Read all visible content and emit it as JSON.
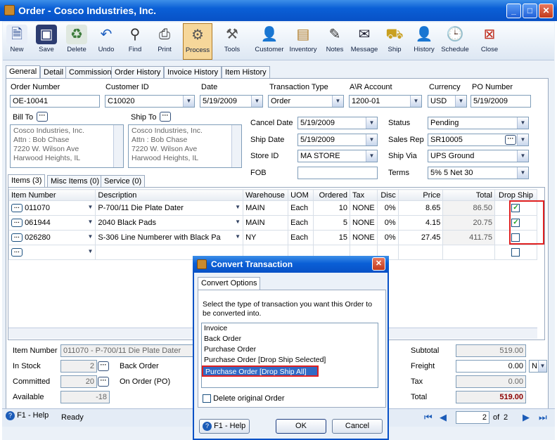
{
  "window": {
    "title": "Order - Cosco Industries, Inc."
  },
  "toolbar": {
    "items": [
      "New",
      "Save",
      "Delete",
      "Undo",
      "Find",
      "Print",
      "Process",
      "Tools",
      "Customer",
      "Inventory",
      "Notes",
      "Message",
      "Ship",
      "History",
      "Schedule",
      "Close"
    ]
  },
  "tabs": [
    "General",
    "Detail",
    "Commission",
    "Order History",
    "Invoice History",
    "Item History"
  ],
  "header": {
    "order_number_label": "Order Number",
    "order_number": "OE-10041",
    "customer_id_label": "Customer ID",
    "customer_id": "C10020",
    "date_label": "Date",
    "date": "5/19/2009",
    "transaction_type_label": "Transaction Type",
    "transaction_type": "Order",
    "ar_account_label": "A\\R Account",
    "ar_account": "1200-01",
    "currency_label": "Currency",
    "currency": "USD",
    "po_number_label": "PO Number",
    "po_number": "5/19/2009"
  },
  "bill_to": {
    "label": "Bill To",
    "lines": [
      "Cosco Industries, Inc.",
      "Attn : Bob Chase",
      "7220 W. Wilson Ave",
      "Harwood Heights, IL"
    ]
  },
  "ship_to": {
    "label": "Ship To",
    "lines": [
      "Cosco Industries, Inc.",
      "Attn : Bob Chase",
      "7220 W. Wilson Ave",
      "Harwood Heights, IL"
    ]
  },
  "mid": {
    "cancel_date_label": "Cancel  Date",
    "cancel_date": "5/19/2009",
    "ship_date_label": "Ship Date",
    "ship_date": "5/19/2009",
    "store_id_label": "Store ID",
    "store_id": "MA STORE",
    "fob_label": "FOB",
    "fob": ""
  },
  "right": {
    "status_label": "Status",
    "status": "Pending",
    "sales_rep_label": "Sales Rep",
    "sales_rep": "SR10005",
    "ship_via_label": "Ship Via",
    "ship_via": "UPS Ground",
    "terms_label": "Terms",
    "terms": "5% 5 Net 30"
  },
  "item_tabs": [
    "Items (3)",
    "Misc Items (0)",
    "Service (0)"
  ],
  "grid": {
    "columns": [
      "Item Number",
      "Description",
      "Warehouse",
      "UOM",
      "Ordered",
      "Tax",
      "Disc",
      "Price",
      "Total",
      "Drop Ship"
    ],
    "rows": [
      {
        "item": "011070",
        "desc": "P-700/11 Die Plate Dater",
        "wh": "MAIN",
        "uom": "Each",
        "ordered": "10",
        "tax": "NONE",
        "disc": "0%",
        "price": "8.65",
        "total": "86.50",
        "drop": true
      },
      {
        "item": "061944",
        "desc": "2040 Black Pads",
        "wh": "MAIN",
        "uom": "Each",
        "ordered": "5",
        "tax": "NONE",
        "disc": "0%",
        "price": "4.15",
        "total": "20.75",
        "drop": true
      },
      {
        "item": "026280",
        "desc": "S-306 Line Numberer with Black Pa",
        "wh": "NY",
        "uom": "Each",
        "ordered": "15",
        "tax": "NONE",
        "disc": "0%",
        "price": "27.45",
        "total": "411.75",
        "drop": false
      }
    ]
  },
  "bottom": {
    "item_number_label": "Item Number",
    "item_number": "011070 - P-700/11 Die Plate Dater",
    "in_stock_label": "In Stock",
    "in_stock": "2",
    "committed_label": "Committed",
    "committed": "20",
    "available_label": "Available",
    "available": "-18",
    "back_order_label": "Back Order",
    "on_order_label": "On Order (PO)"
  },
  "totals": {
    "subtotal_label": "Subtotal",
    "subtotal": "519.00",
    "freight_label": "Freight",
    "freight": "0.00",
    "freight_code": "N",
    "tax_label": "Tax",
    "tax": "0.00",
    "total_label": "Total",
    "total": "519.00"
  },
  "status": {
    "help": "F1 - Help",
    "ready": "Ready",
    "page": "2",
    "of": "of",
    "page_total": "2"
  },
  "dialog": {
    "title": "Convert Transaction",
    "tab": "Convert  Options",
    "instruction": "Select the type of transaction you want this Order to be converted into.",
    "options": [
      "Invoice",
      "Back Order",
      "Purchase Order",
      "Purchase Order [Drop Ship Selected]",
      "Purchase Order [Drop Ship All]"
    ],
    "selected_index": 4,
    "delete_label": "Delete original Order",
    "help": "F1 - Help",
    "ok": "OK",
    "cancel": "Cancel"
  }
}
